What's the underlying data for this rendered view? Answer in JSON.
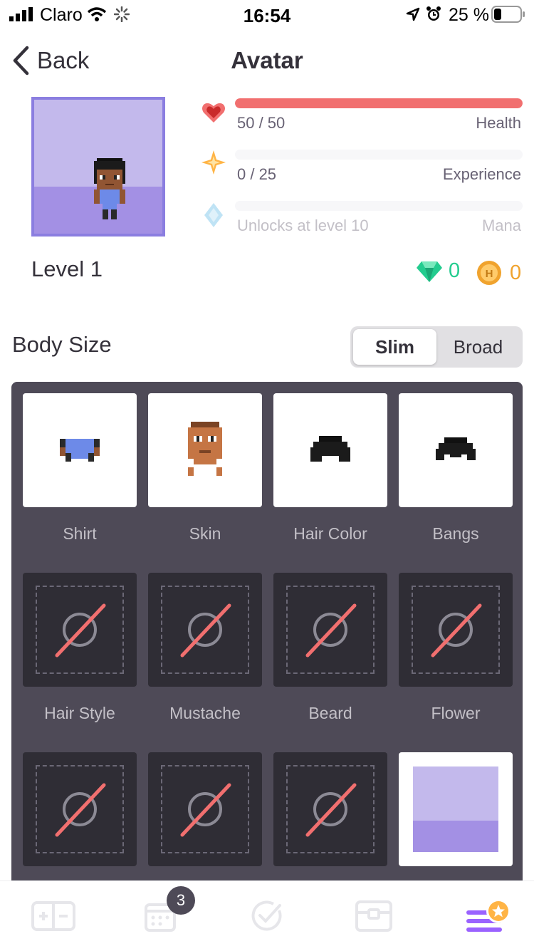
{
  "status_bar": {
    "carrier": "Claro",
    "time": "16:54",
    "battery": "25 %"
  },
  "nav": {
    "back_label": "Back",
    "title": "Avatar"
  },
  "avatar": {
    "level_label": "Level 1"
  },
  "stats": {
    "health": {
      "value": "50 / 50",
      "label": "Health",
      "fill": 1.0,
      "color": "#f16f6f"
    },
    "experience": {
      "value": "0 / 25",
      "label": "Experience",
      "fill": 0.0,
      "color": "#ffb445"
    },
    "mana": {
      "value": "Unlocks at level 10",
      "label": "Mana",
      "fill": 0.0,
      "color": "#50b5e9"
    }
  },
  "currency": {
    "gems": "0",
    "gold": "0",
    "gem_color": "#24cc8f",
    "gold_color": "#f0a32e"
  },
  "body_size": {
    "title": "Body Size",
    "options": [
      "Slim",
      "Broad"
    ],
    "selected": "Slim"
  },
  "customize": {
    "items": [
      {
        "label": "Shirt",
        "icon": "shirt-icon"
      },
      {
        "label": "Skin",
        "icon": "skin-icon"
      },
      {
        "label": "Hair Color",
        "icon": "hair-color-icon"
      },
      {
        "label": "Bangs",
        "icon": "bangs-icon"
      },
      {
        "label": "Hair Style",
        "icon": "none-icon"
      },
      {
        "label": "Mustache",
        "icon": "none-icon"
      },
      {
        "label": "Beard",
        "icon": "none-icon"
      },
      {
        "label": "Flower",
        "icon": "none-icon"
      },
      {
        "label": "",
        "icon": "none-icon"
      },
      {
        "label": "",
        "icon": "none-icon"
      },
      {
        "label": "",
        "icon": "none-icon"
      },
      {
        "label": "",
        "icon": "background-icon"
      }
    ]
  },
  "tab_bar": {
    "tabs": [
      "habits-icon",
      "dailies-icon",
      "todos-icon",
      "rewards-icon",
      "menu-icon"
    ],
    "dailies_badge": "3",
    "accent": "#9a62ff"
  }
}
